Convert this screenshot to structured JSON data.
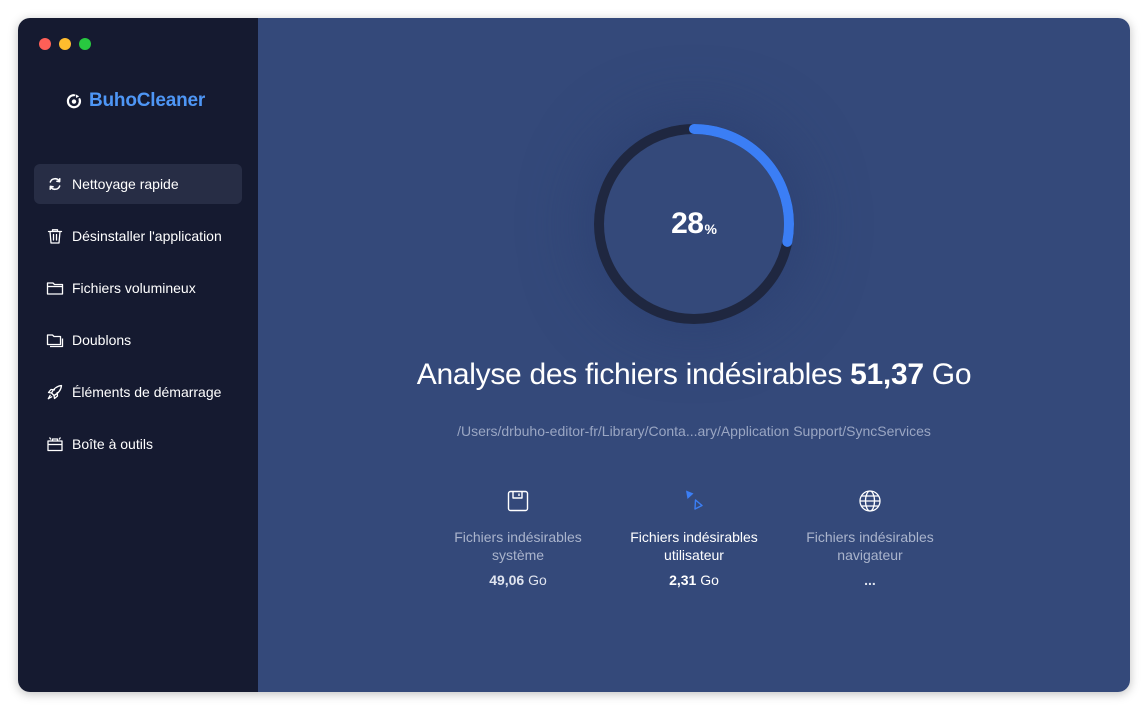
{
  "app": {
    "name": "BuhoCleaner"
  },
  "sidebar": {
    "items": [
      {
        "label": "Nettoyage rapide",
        "icon": "refresh-icon",
        "active": true
      },
      {
        "label": "Désinstaller l'application",
        "icon": "trash-icon",
        "active": false
      },
      {
        "label": "Fichiers volumineux",
        "icon": "folder-icon",
        "active": false
      },
      {
        "label": "Doublons",
        "icon": "duplicate-folder-icon",
        "active": false
      },
      {
        "label": "Éléments de démarrage",
        "icon": "rocket-icon",
        "active": false
      },
      {
        "label": "Boîte à outils",
        "icon": "toolbox-icon",
        "active": false
      }
    ]
  },
  "scan": {
    "percent": "28",
    "percent_unit": "%",
    "progress_fraction": 0.28,
    "headline_prefix": "Analyse des fichiers indésirables",
    "headline_size_value": "51,37",
    "headline_size_unit": "Go",
    "current_path": "/Users/drbuho-editor-fr/Library/Conta...ary/Application Support/SyncServices"
  },
  "categories": [
    {
      "label_line1": "Fichiers indésirables",
      "label_line2": "système",
      "value": "49,06",
      "unit": "Go",
      "icon": "disk-icon"
    },
    {
      "label_line1": "Fichiers indésirables",
      "label_line2": "utilisateur",
      "value": "2,31",
      "unit": "Go",
      "icon": "user-junk-icon"
    },
    {
      "label_line1": "Fichiers indésirables",
      "label_line2": "navigateur",
      "value": "...",
      "unit": "",
      "icon": "globe-icon"
    }
  ],
  "colors": {
    "accent": "#3b7ef5",
    "sidebar_bg": "#151a30",
    "main_bg": "#34497a",
    "brand": "#4e96f5",
    "ring_track": "#1f2740"
  }
}
